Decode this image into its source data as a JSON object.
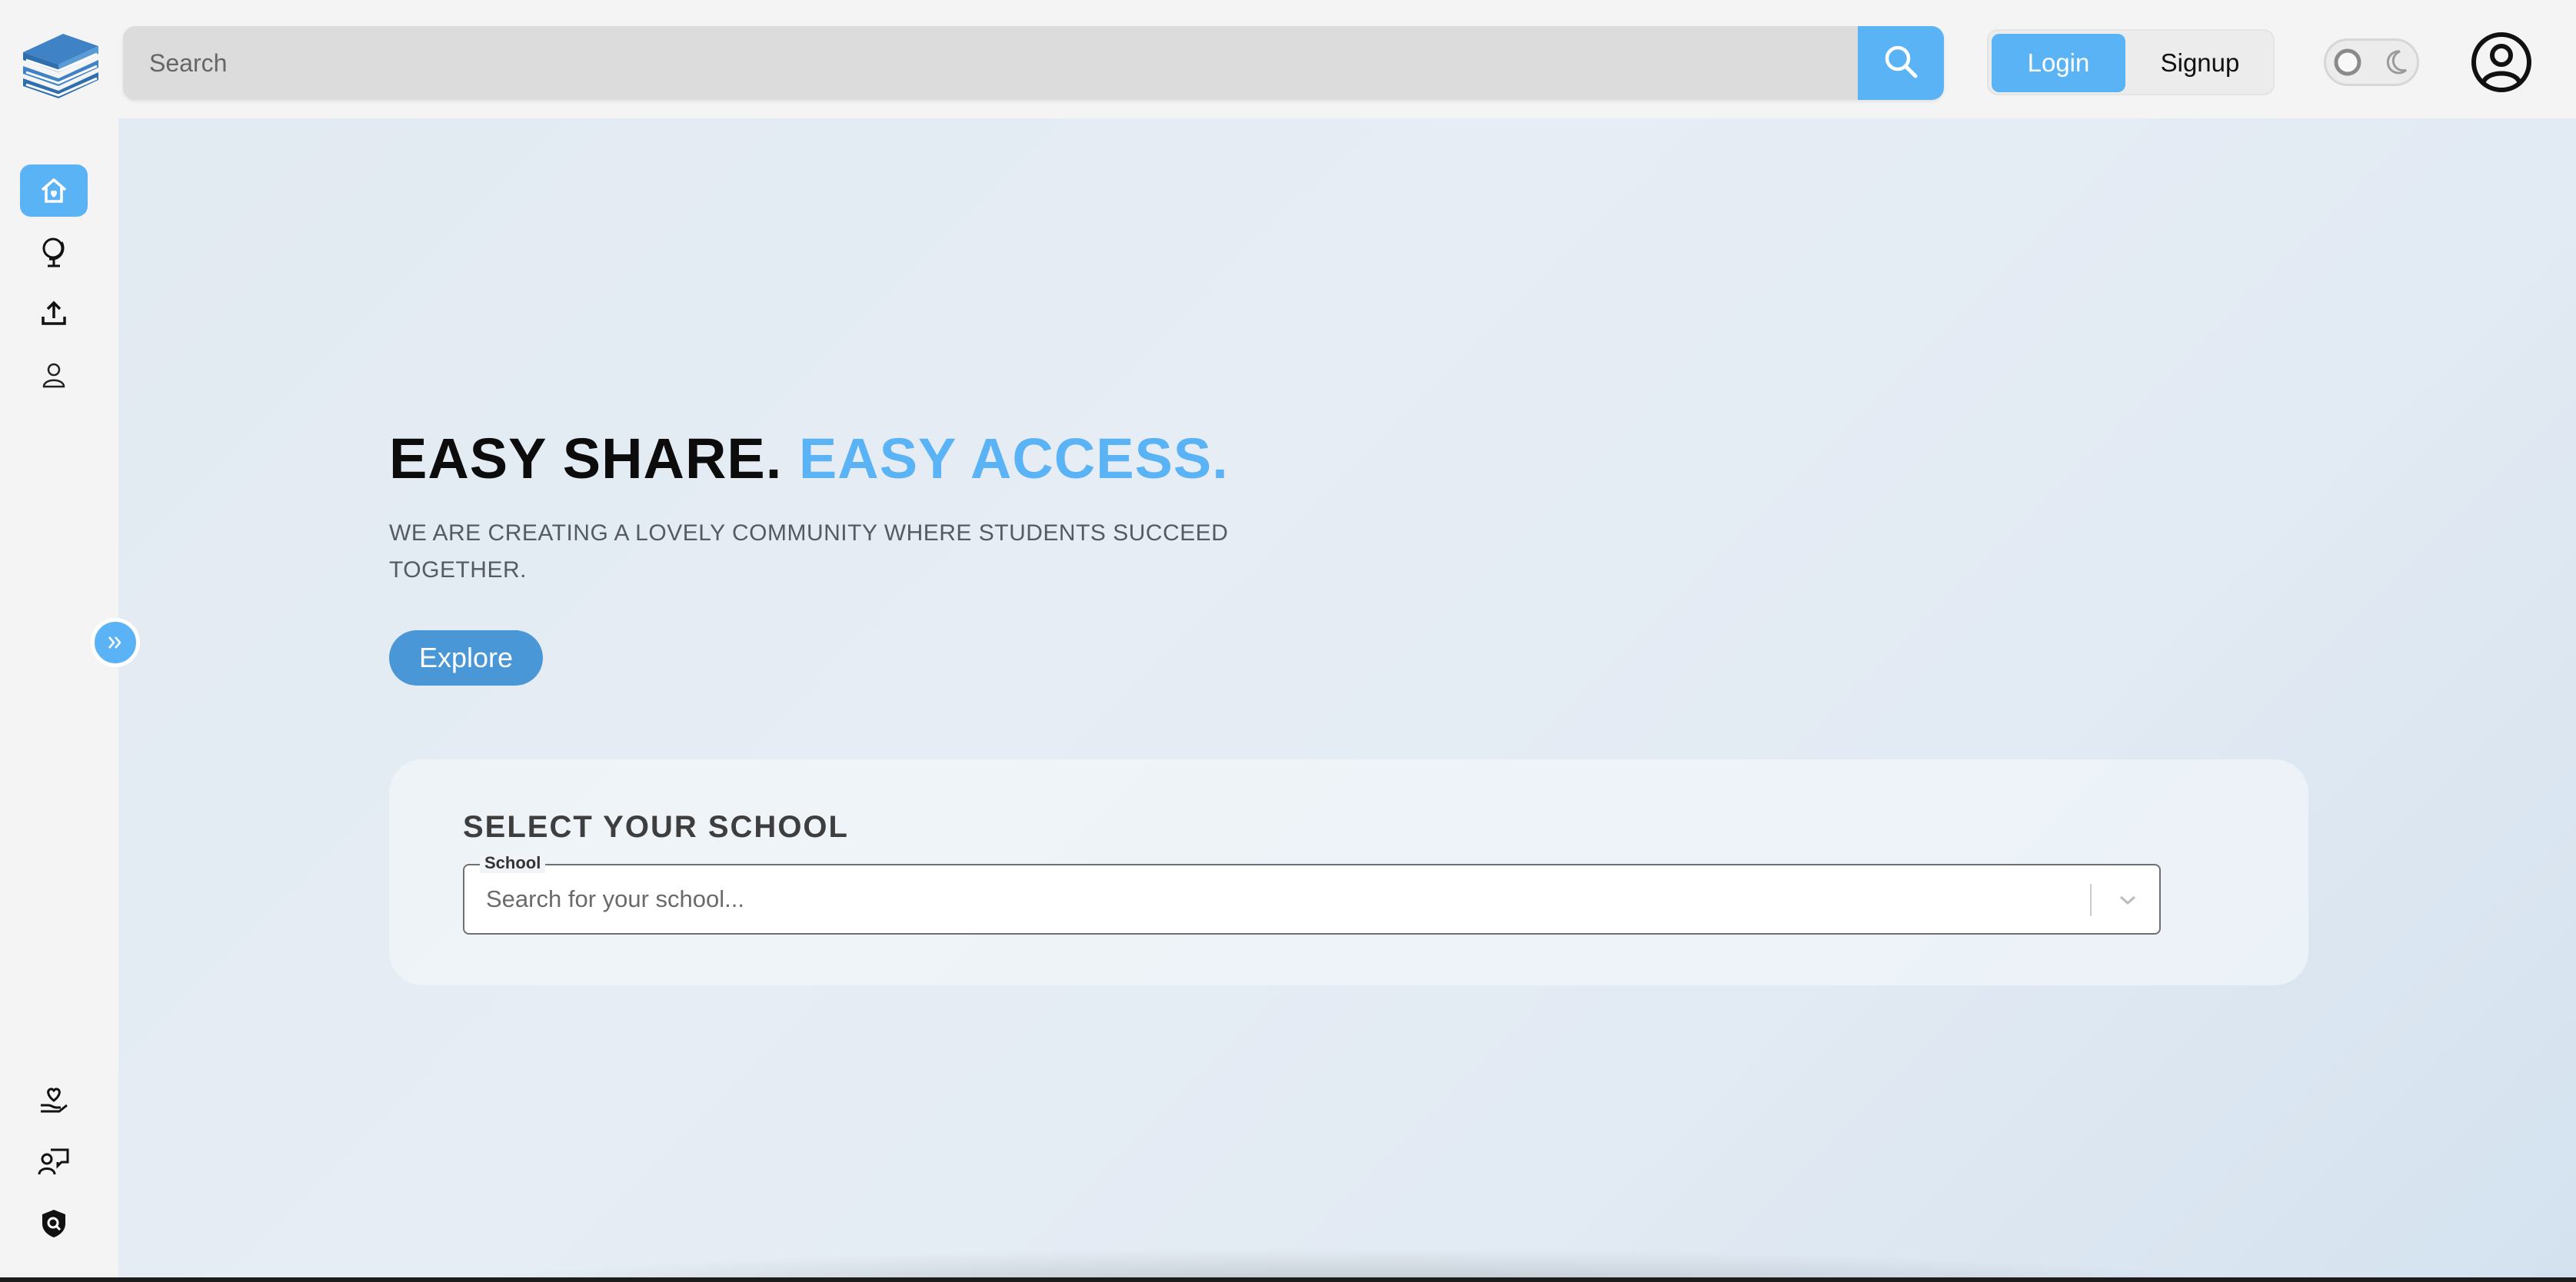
{
  "header": {
    "search_placeholder": "Search",
    "login_label": "Login",
    "signup_label": "Signup",
    "theme": "light"
  },
  "sidebar": {
    "items": [
      {
        "name": "home",
        "icon": "home-icon",
        "active": true
      },
      {
        "name": "explore",
        "icon": "globe-icon",
        "active": false
      },
      {
        "name": "upload",
        "icon": "upload-icon",
        "active": false
      },
      {
        "name": "profile",
        "icon": "user-icon",
        "active": false
      }
    ],
    "bottom_items": [
      {
        "name": "donate",
        "icon": "heart-hand-icon"
      },
      {
        "name": "feedback",
        "icon": "user-chat-icon"
      },
      {
        "name": "privacy",
        "icon": "shield-icon"
      }
    ],
    "collapse_icon": "chevron-double-right-icon"
  },
  "hero": {
    "title_part1": "EASY SHARE.",
    "title_part2": "EASY ACCESS.",
    "subtitle": "WE ARE CREATING A LOVELY COMMUNITY WHERE STUDENTS SUCCEED TOGETHER.",
    "explore_label": "Explore"
  },
  "school": {
    "title": "SELECT YOUR SCHOOL",
    "field_label": "School",
    "placeholder": "Search for your school..."
  },
  "colors": {
    "accent": "#5ab3f5",
    "explore": "#4a97d8",
    "logo": "#3f83c6"
  }
}
